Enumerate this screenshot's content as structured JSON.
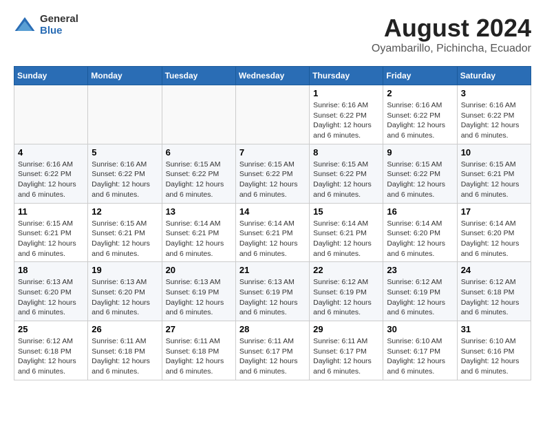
{
  "logo": {
    "general": "General",
    "blue": "Blue"
  },
  "title": "August 2024",
  "location": "Oyambarillo, Pichincha, Ecuador",
  "days_of_week": [
    "Sunday",
    "Monday",
    "Tuesday",
    "Wednesday",
    "Thursday",
    "Friday",
    "Saturday"
  ],
  "weeks": [
    [
      {
        "day": "",
        "info": ""
      },
      {
        "day": "",
        "info": ""
      },
      {
        "day": "",
        "info": ""
      },
      {
        "day": "",
        "info": ""
      },
      {
        "day": "1",
        "info": "Sunrise: 6:16 AM\nSunset: 6:22 PM\nDaylight: 12 hours and 6 minutes."
      },
      {
        "day": "2",
        "info": "Sunrise: 6:16 AM\nSunset: 6:22 PM\nDaylight: 12 hours and 6 minutes."
      },
      {
        "day": "3",
        "info": "Sunrise: 6:16 AM\nSunset: 6:22 PM\nDaylight: 12 hours and 6 minutes."
      }
    ],
    [
      {
        "day": "4",
        "info": "Sunrise: 6:16 AM\nSunset: 6:22 PM\nDaylight: 12 hours and 6 minutes."
      },
      {
        "day": "5",
        "info": "Sunrise: 6:16 AM\nSunset: 6:22 PM\nDaylight: 12 hours and 6 minutes."
      },
      {
        "day": "6",
        "info": "Sunrise: 6:15 AM\nSunset: 6:22 PM\nDaylight: 12 hours and 6 minutes."
      },
      {
        "day": "7",
        "info": "Sunrise: 6:15 AM\nSunset: 6:22 PM\nDaylight: 12 hours and 6 minutes."
      },
      {
        "day": "8",
        "info": "Sunrise: 6:15 AM\nSunset: 6:22 PM\nDaylight: 12 hours and 6 minutes."
      },
      {
        "day": "9",
        "info": "Sunrise: 6:15 AM\nSunset: 6:22 PM\nDaylight: 12 hours and 6 minutes."
      },
      {
        "day": "10",
        "info": "Sunrise: 6:15 AM\nSunset: 6:21 PM\nDaylight: 12 hours and 6 minutes."
      }
    ],
    [
      {
        "day": "11",
        "info": "Sunrise: 6:15 AM\nSunset: 6:21 PM\nDaylight: 12 hours and 6 minutes."
      },
      {
        "day": "12",
        "info": "Sunrise: 6:15 AM\nSunset: 6:21 PM\nDaylight: 12 hours and 6 minutes."
      },
      {
        "day": "13",
        "info": "Sunrise: 6:14 AM\nSunset: 6:21 PM\nDaylight: 12 hours and 6 minutes."
      },
      {
        "day": "14",
        "info": "Sunrise: 6:14 AM\nSunset: 6:21 PM\nDaylight: 12 hours and 6 minutes."
      },
      {
        "day": "15",
        "info": "Sunrise: 6:14 AM\nSunset: 6:21 PM\nDaylight: 12 hours and 6 minutes."
      },
      {
        "day": "16",
        "info": "Sunrise: 6:14 AM\nSunset: 6:20 PM\nDaylight: 12 hours and 6 minutes."
      },
      {
        "day": "17",
        "info": "Sunrise: 6:14 AM\nSunset: 6:20 PM\nDaylight: 12 hours and 6 minutes."
      }
    ],
    [
      {
        "day": "18",
        "info": "Sunrise: 6:13 AM\nSunset: 6:20 PM\nDaylight: 12 hours and 6 minutes."
      },
      {
        "day": "19",
        "info": "Sunrise: 6:13 AM\nSunset: 6:20 PM\nDaylight: 12 hours and 6 minutes."
      },
      {
        "day": "20",
        "info": "Sunrise: 6:13 AM\nSunset: 6:19 PM\nDaylight: 12 hours and 6 minutes."
      },
      {
        "day": "21",
        "info": "Sunrise: 6:13 AM\nSunset: 6:19 PM\nDaylight: 12 hours and 6 minutes."
      },
      {
        "day": "22",
        "info": "Sunrise: 6:12 AM\nSunset: 6:19 PM\nDaylight: 12 hours and 6 minutes."
      },
      {
        "day": "23",
        "info": "Sunrise: 6:12 AM\nSunset: 6:19 PM\nDaylight: 12 hours and 6 minutes."
      },
      {
        "day": "24",
        "info": "Sunrise: 6:12 AM\nSunset: 6:18 PM\nDaylight: 12 hours and 6 minutes."
      }
    ],
    [
      {
        "day": "25",
        "info": "Sunrise: 6:12 AM\nSunset: 6:18 PM\nDaylight: 12 hours and 6 minutes."
      },
      {
        "day": "26",
        "info": "Sunrise: 6:11 AM\nSunset: 6:18 PM\nDaylight: 12 hours and 6 minutes."
      },
      {
        "day": "27",
        "info": "Sunrise: 6:11 AM\nSunset: 6:18 PM\nDaylight: 12 hours and 6 minutes."
      },
      {
        "day": "28",
        "info": "Sunrise: 6:11 AM\nSunset: 6:17 PM\nDaylight: 12 hours and 6 minutes."
      },
      {
        "day": "29",
        "info": "Sunrise: 6:11 AM\nSunset: 6:17 PM\nDaylight: 12 hours and 6 minutes."
      },
      {
        "day": "30",
        "info": "Sunrise: 6:10 AM\nSunset: 6:17 PM\nDaylight: 12 hours and 6 minutes."
      },
      {
        "day": "31",
        "info": "Sunrise: 6:10 AM\nSunset: 6:16 PM\nDaylight: 12 hours and 6 minutes."
      }
    ]
  ]
}
